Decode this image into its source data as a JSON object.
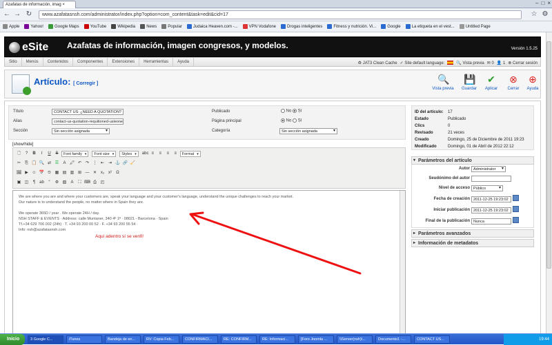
{
  "browser": {
    "tab_title": "Azafatas de información, imag",
    "url": "www.azafatasnsh.com/administrator/index.php?option=com_content&task=edit&cid=17",
    "bookmarks": [
      "Apple",
      "Yahoo!",
      "Google Maps",
      "YouTube",
      "Wikipedia",
      "News",
      "Popular",
      "Judaica Heaven.com -...",
      "VPN Vodafone",
      "Drogas inteligentes",
      "Fitness y nutrición. Vi...",
      "Google",
      "La etiqueta en el vest...",
      "Untitled Page"
    ],
    "bookmark_colors": [
      "#888888",
      "#7b0099",
      "#3a9a3a",
      "#cc0000",
      "#444444",
      "#555555",
      "#777777",
      "#2a6bd1",
      "#d33",
      "#2a6bd1",
      "#2a6bd1",
      "#2a6bd1",
      "#2a6bd1",
      "#999999"
    ]
  },
  "header": {
    "logo": "eSite",
    "site_title": "Azafatas de información, imagen congresos, y modelos.",
    "version": "Versión 1.5.25"
  },
  "menu": {
    "items": [
      "Sitio",
      "Menús",
      "Contenidos",
      "Componentes",
      "Extensiones",
      "Herramientas",
      "Ayuda"
    ],
    "status": {
      "cache": "JAT3 Clean Cache",
      "language": "Site default language:",
      "preview": "Vista previa",
      "messages": "0",
      "users": "1",
      "logout": "Cerrar sesión"
    }
  },
  "toolbar": {
    "title": "Artículo:",
    "subtitle": "[ Corregir ]",
    "buttons": [
      "Vista previa",
      "Guardar",
      "Aplicar",
      "Cerrar",
      "Ayuda"
    ]
  },
  "form": {
    "title_label": "Título",
    "title_value": "CONTACT US: ¿NEED A QUOTATION?",
    "alias_label": "Alias",
    "alias_value": "contact-us-quotation-requitioned-usleoner",
    "section_label": "Sección",
    "section_value": "Sin sección asignada",
    "published_label": "Publicado",
    "frontpage_label": "Página principal",
    "category_label": "Categoría",
    "category_value": "Sin sección asignada",
    "no": "No",
    "yes": "Sí"
  },
  "editor": {
    "showhide": "[show/hide]",
    "font_family": "Font family",
    "font_size": "Font size",
    "styles": "Styles",
    "format": "Format",
    "lines": [
      "We are where you are and where your customers are, speak your language and your customer's language, understand the unique challenges to reach your market.",
      "Our nature is to understand the people, no matter where in Spain they are.",
      "",
      "We operate 365D / year . We operate 24H / day.",
      "NSH STAFF & EVENTS · Address: calle Muntaner, 340 4º 1ª · 08021 - Barcelona · Spain",
      "Tf.+34 629 706 002 (24h) · T. +34 93 200 00 52 · F. +34 93 200 55 54 ·",
      "Info: nsh@azafatasnsh.com"
    ],
    "annotation": "Aquí adentro sí se venfi!"
  },
  "info": {
    "rows": [
      [
        "ID del artículo:",
        "17"
      ],
      [
        "Estado",
        "Publicado"
      ],
      [
        "Clics",
        "0"
      ],
      [
        "Revisado",
        "21 veces"
      ],
      [
        "Creado",
        "Domingo, 25 de Diciembre de 2011 19:23"
      ],
      [
        "Modificado",
        "Domingo, 01 de Abril de 2012 22:12"
      ]
    ]
  },
  "params": {
    "header": "Parámetros del artículo",
    "author_label": "Autor",
    "author_value": "Administrator",
    "alias_author_label": "Seudónimo del autor",
    "access_label": "Nivel de acceso",
    "access_value": "Público",
    "created_label": "Fecha de creación",
    "created_value": "2011-12-25 19:23:02",
    "start_label": "Iniciar publicación",
    "start_value": "2011-12-25 19:23:02",
    "end_label": "Final de la publicación",
    "end_value": "Nunca",
    "advanced": "Parámetros avanzados",
    "metadata": "Información de metadatos"
  },
  "taskbar": {
    "start": "Inicio",
    "tasks": [
      "3 Google C...",
      "iTunes",
      "Bandeja de en...",
      "RV: Copia Feb...",
      "CONFIRMACI...",
      "RE: CONFIRM...",
      "RE: Informaci...",
      "[Foro Joomla ...",
      "\\\\Server(nsh)\\...",
      "Documento1 -...",
      "CONTACT US..."
    ],
    "clock": "19:44"
  }
}
